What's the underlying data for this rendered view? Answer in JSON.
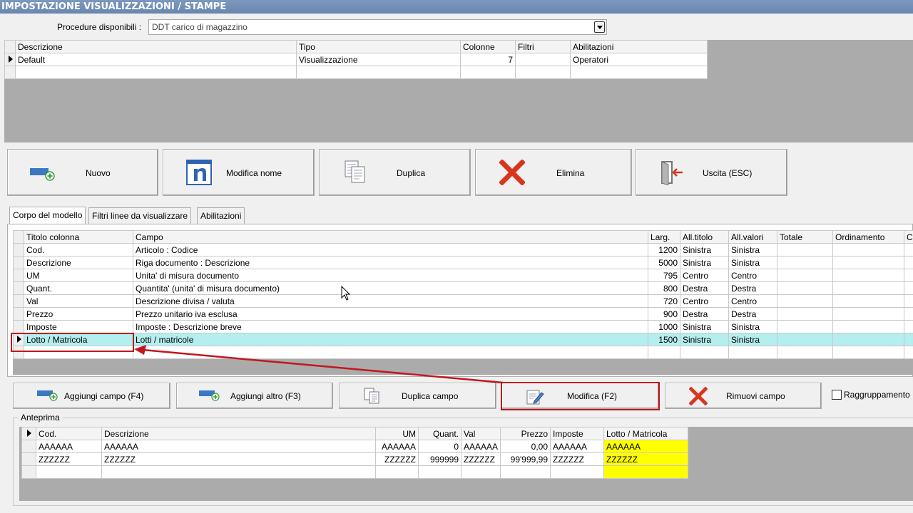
{
  "window": {
    "title": "IMPOSTAZIONE VISUALIZZAZIONI / STAMPE"
  },
  "procedure": {
    "label": "Procedure disponibili :",
    "value": "DDT carico di magazzino"
  },
  "models_table": {
    "headers": [
      "Descrizione",
      "Tipo",
      "Colonne",
      "Filtri",
      "Abilitazioni"
    ],
    "rows": [
      [
        "Default",
        "Visualizzazione",
        "7",
        "",
        "Operatori"
      ]
    ]
  },
  "toolbar": {
    "nuovo": "Nuovo",
    "modifica_nome": "Modifica nome",
    "duplica": "Duplica",
    "elimina": "Elimina",
    "uscita": "Uscita (ESC)"
  },
  "tabs": [
    "Corpo del modello",
    "Filtri linee da visualizzare",
    "Abilitazioni"
  ],
  "columns_table": {
    "headers": [
      "Titolo colonna",
      "Campo",
      "Larg.",
      "All.titolo",
      "All.valori",
      "Totale",
      "Ordinamento",
      "C"
    ],
    "rows": [
      [
        "Cod.",
        "Articolo : Codice",
        "1200",
        "Sinistra",
        "Sinistra"
      ],
      [
        "Descrizione",
        "Riga documento : Descrizione",
        "5000",
        "Sinistra",
        "Sinistra"
      ],
      [
        "UM",
        "Unita' di misura documento",
        "795",
        "Centro",
        "Centro"
      ],
      [
        "Quant.",
        "Quantita' (unita' di misura documento)",
        "800",
        "Destra",
        "Destra"
      ],
      [
        "Val",
        "Descrizione divisa / valuta",
        "720",
        "Centro",
        "Centro"
      ],
      [
        "Prezzo",
        "Prezzo unitario iva esclusa",
        "900",
        "Destra",
        "Destra"
      ],
      [
        "Imposte",
        "Imposte : Descrizione breve",
        "1000",
        "Sinistra",
        "Sinistra"
      ],
      [
        "Lotto / Matricola",
        "Lotti / matricole",
        "1500",
        "Sinistra",
        "Sinistra"
      ]
    ]
  },
  "field_buttons": {
    "aggiungi_campo": "Aggiungi campo (F4)",
    "aggiungi_altro": "Aggiungi altro (F3)",
    "duplica_campo": "Duplica campo",
    "modifica": "Modifica (F2)",
    "rimuovi_campo": "Rimuovi campo",
    "raggruppamento": "Raggruppamento"
  },
  "preview": {
    "label": "Anteprima",
    "headers": [
      "Cod.",
      "Descrizione",
      "UM",
      "Quant.",
      "Val",
      "Prezzo",
      "Imposte",
      "Lotto / Matricola"
    ],
    "rows": [
      [
        "AAAAAA",
        "AAAAAA",
        "AAAAAA",
        "0",
        "AAAAAA",
        "0,00",
        "AAAAAA",
        "AAAAAA"
      ],
      [
        "ZZZZZZ",
        "ZZZZZZ",
        "ZZZZZZ",
        "999999",
        "ZZZZZZ",
        "99'999,99",
        "ZZZZZZ",
        "ZZZZZZ"
      ]
    ]
  },
  "colors": {
    "highlight_row": "#b4eeee",
    "preview_highlight": "#ffff00",
    "annotation": "#c0171c"
  }
}
